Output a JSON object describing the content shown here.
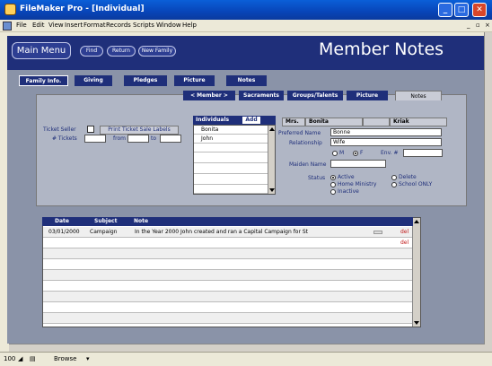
{
  "window": {
    "title": "FileMaker Pro - [Individual]",
    "menu": [
      "File",
      "Edit",
      "View",
      "Insert",
      "Format",
      "Records",
      "Scripts",
      "Window",
      "Help"
    ]
  },
  "header": {
    "main_menu": "Main Menu",
    "buttons": [
      "Find",
      "Return",
      "New Family"
    ],
    "title": "Member Notes"
  },
  "top_tabs": [
    "Family Info.",
    "Giving",
    "Pledges",
    "Picture",
    "Notes"
  ],
  "sub_tabs": [
    "< Member >",
    "Sacraments",
    "Groups/Talents",
    "Picture",
    "Notes"
  ],
  "ticket": {
    "seller_label": "Ticket Seller",
    "print_label": "Print Ticket Sale Labels",
    "tickets_label": "# Tickets",
    "from_label": "from",
    "to_label": "to"
  },
  "individuals": {
    "header": "Individuals",
    "add": "Add",
    "names": [
      "Bonita",
      "John"
    ]
  },
  "person": {
    "salutation": "Mrs.",
    "first": "Bonita",
    "last": "Kriak",
    "preferred_label": "Preferred Name",
    "preferred_value": "Bonne",
    "relationship_label": "Relationship",
    "relationship_value": "Wife",
    "gender_m": "M",
    "gender_f": "F",
    "env_label": "Env. #",
    "maiden_label": "Maiden Name",
    "status_label": "Status",
    "status_options": [
      "Active",
      "Delete",
      "Home Ministry",
      "School ONLY",
      "Inactive"
    ]
  },
  "notes": {
    "headers": [
      "Date",
      "Subject",
      "Note"
    ],
    "rows": [
      {
        "date": "03/01/2000",
        "subject": "Campaign",
        "note": "In the Year 2000 John created and ran a Capital Campaign for St",
        "del": "del"
      },
      {
        "date": "",
        "subject": "",
        "note": "",
        "del": "del"
      }
    ]
  },
  "status_bar": {
    "zoom": "100",
    "mode": "Browse"
  },
  "colors": {
    "navy": "#1f2f7a",
    "panel": "#b0b6c5",
    "band": "#8a93a8",
    "del_red": "#c01818"
  }
}
